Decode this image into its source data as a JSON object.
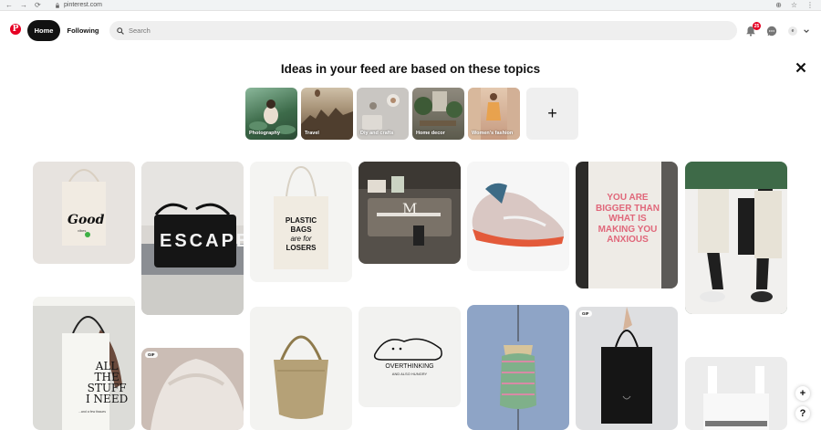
{
  "browser": {
    "back_icon": "←",
    "forward_icon": "→",
    "reload_icon": "⟳",
    "url": "pinterest.com"
  },
  "header": {
    "logo_letter": "P",
    "home_label": "Home",
    "following_label": "Following",
    "search_placeholder": "Search",
    "notification_count": "25",
    "avatar_letter": "e"
  },
  "topics": {
    "title": "Ideas in your feed are based on these topics",
    "items": [
      {
        "label": "Photography",
        "color": "#4a7a5a"
      },
      {
        "label": "Travel",
        "color": "#7a6a58"
      },
      {
        "label": "Diy and crafts",
        "color": "#b9b5b0"
      },
      {
        "label": "Home decor",
        "color": "#4f5a48"
      },
      {
        "label": "Women's fashion",
        "color": "#c9a18a"
      }
    ],
    "add_label": "+"
  },
  "pins": {
    "pin1_text": "Good",
    "pin1_sub": "vibes",
    "pin2_text": "ESCAPE",
    "pin3_lines": [
      "PLASTIC",
      "BAGS",
      "are for",
      "LOSERS"
    ],
    "pin4_letter": "M",
    "pin6_lines": [
      "YOU ARE",
      "BIGGER THAN",
      "WHAT IS",
      "MAKING YOU",
      "ANXIOUS"
    ],
    "pin8_lines": [
      "ALL",
      "THE",
      "STUFF",
      "I NEED"
    ],
    "pin8_foot": "...and a few tissues",
    "pin11_line1": "OVERTHINKING",
    "pin11_line2": "AND ALSO HUNGRY",
    "gif_label": "GIF"
  },
  "fabs": {
    "add": "+",
    "help": "?"
  }
}
